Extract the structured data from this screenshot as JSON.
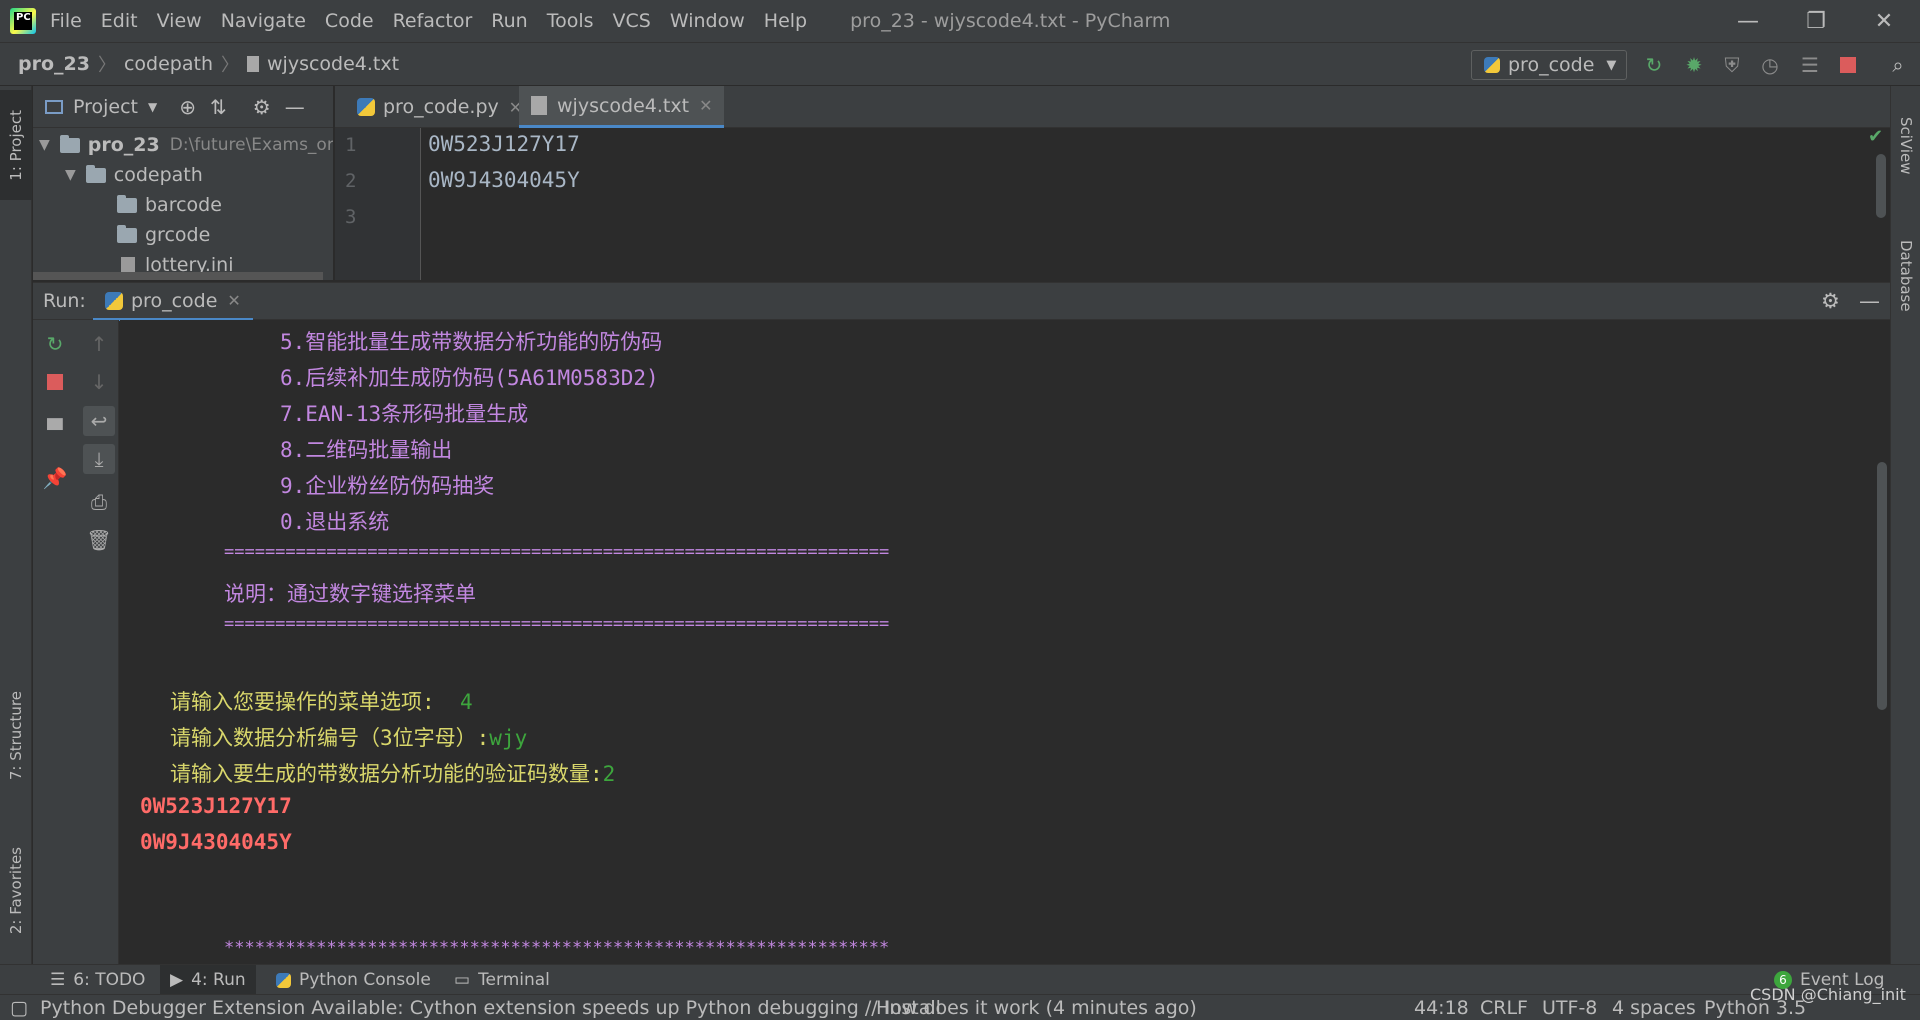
{
  "window": {
    "title": "pro_23 - wjyscode4.txt - PyCharm",
    "menu": [
      "File",
      "Edit",
      "View",
      "Navigate",
      "Code",
      "Refactor",
      "Run",
      "Tools",
      "VCS",
      "Window",
      "Help"
    ]
  },
  "breadcrumbs": [
    "pro_23",
    "codepath",
    "wjyscode4.txt"
  ],
  "run_config": "pro_code",
  "project_panel": {
    "title": "Project",
    "tree": [
      {
        "label": "pro_23",
        "path": "D:\\future\\Exams_or_",
        "type": "folder",
        "expanded": true
      },
      {
        "label": "codepath",
        "type": "folder",
        "expanded": true
      },
      {
        "label": "barcode",
        "type": "folder"
      },
      {
        "label": "grcode",
        "type": "folder"
      },
      {
        "label": "lottery.ini",
        "type": "file"
      }
    ]
  },
  "editor": {
    "tabs": [
      {
        "label": "pro_code.py",
        "active": false
      },
      {
        "label": "wjyscode4.txt",
        "active": true
      }
    ],
    "line_numbers": [
      "1",
      "2",
      "3"
    ],
    "lines": [
      "0W523J127Y17",
      "0W9J4304045Y",
      ""
    ]
  },
  "run_panel": {
    "label": "Run:",
    "tab": "pro_code"
  },
  "console": {
    "lines": [
      {
        "text": "5.智能批量生成带数据分析功能的防伪码",
        "color": "purple",
        "indent": 1
      },
      {
        "text": "6.后续补加生成防伪码(5A61M0583D2)",
        "color": "purple",
        "indent": 1
      },
      {
        "text": "7.EAN-13条形码批量生成",
        "color": "purple",
        "indent": 1
      },
      {
        "text": "8.二维码批量输出",
        "color": "purple",
        "indent": 1
      },
      {
        "text": "9.企业粉丝防伪码抽奖",
        "color": "purple",
        "indent": 1
      },
      {
        "text": "0.退出系统",
        "color": "purple",
        "indent": 1
      },
      {
        "text": "=================================================================",
        "color": "purple",
        "indent": 2
      },
      {
        "text": "说明：通过数字键选择菜单",
        "color": "purple",
        "indent": 2
      },
      {
        "text": "=================================================================",
        "color": "purple",
        "indent": 2
      }
    ],
    "prompts": [
      {
        "prompt": "请输入您要操作的菜单选项:  ",
        "input": "4"
      },
      {
        "prompt": "请输入数据分析编号（3位字母）:",
        "input": "wjy"
      },
      {
        "prompt": "请输入要生成的带数据分析功能的验证码数量:",
        "input": "2"
      }
    ],
    "output": [
      "0W523J127Y17",
      "0W9J4304045Y"
    ],
    "stars": "*****************************************************************"
  },
  "left_stripe": {
    "project": "1: Project",
    "structure": "7: Structure",
    "favorites": "2: Favorites"
  },
  "right_stripe": {
    "sciview": "SciView",
    "database": "Database"
  },
  "bottom_tools": {
    "todo": "6: TODO",
    "run": "4: Run",
    "python_console": "Python Console",
    "terminal": "Terminal",
    "event_log": "Event Log"
  },
  "status": {
    "message": "Python Debugger Extension Available: Cython extension speeds up Python debugging // Install",
    "how": "How does it work (4 minutes ago)",
    "position": "44:18",
    "line_sep": "CRLF",
    "encoding": "UTF-8",
    "indent": "4 spaces",
    "interpreter": "Python 3.5",
    "watermark": "CSDN @Chiang_init"
  },
  "colors": {
    "purple": "#c287e0",
    "yellow": "#d9d76b",
    "green": "#3da63d",
    "red": "#ff6b68"
  }
}
